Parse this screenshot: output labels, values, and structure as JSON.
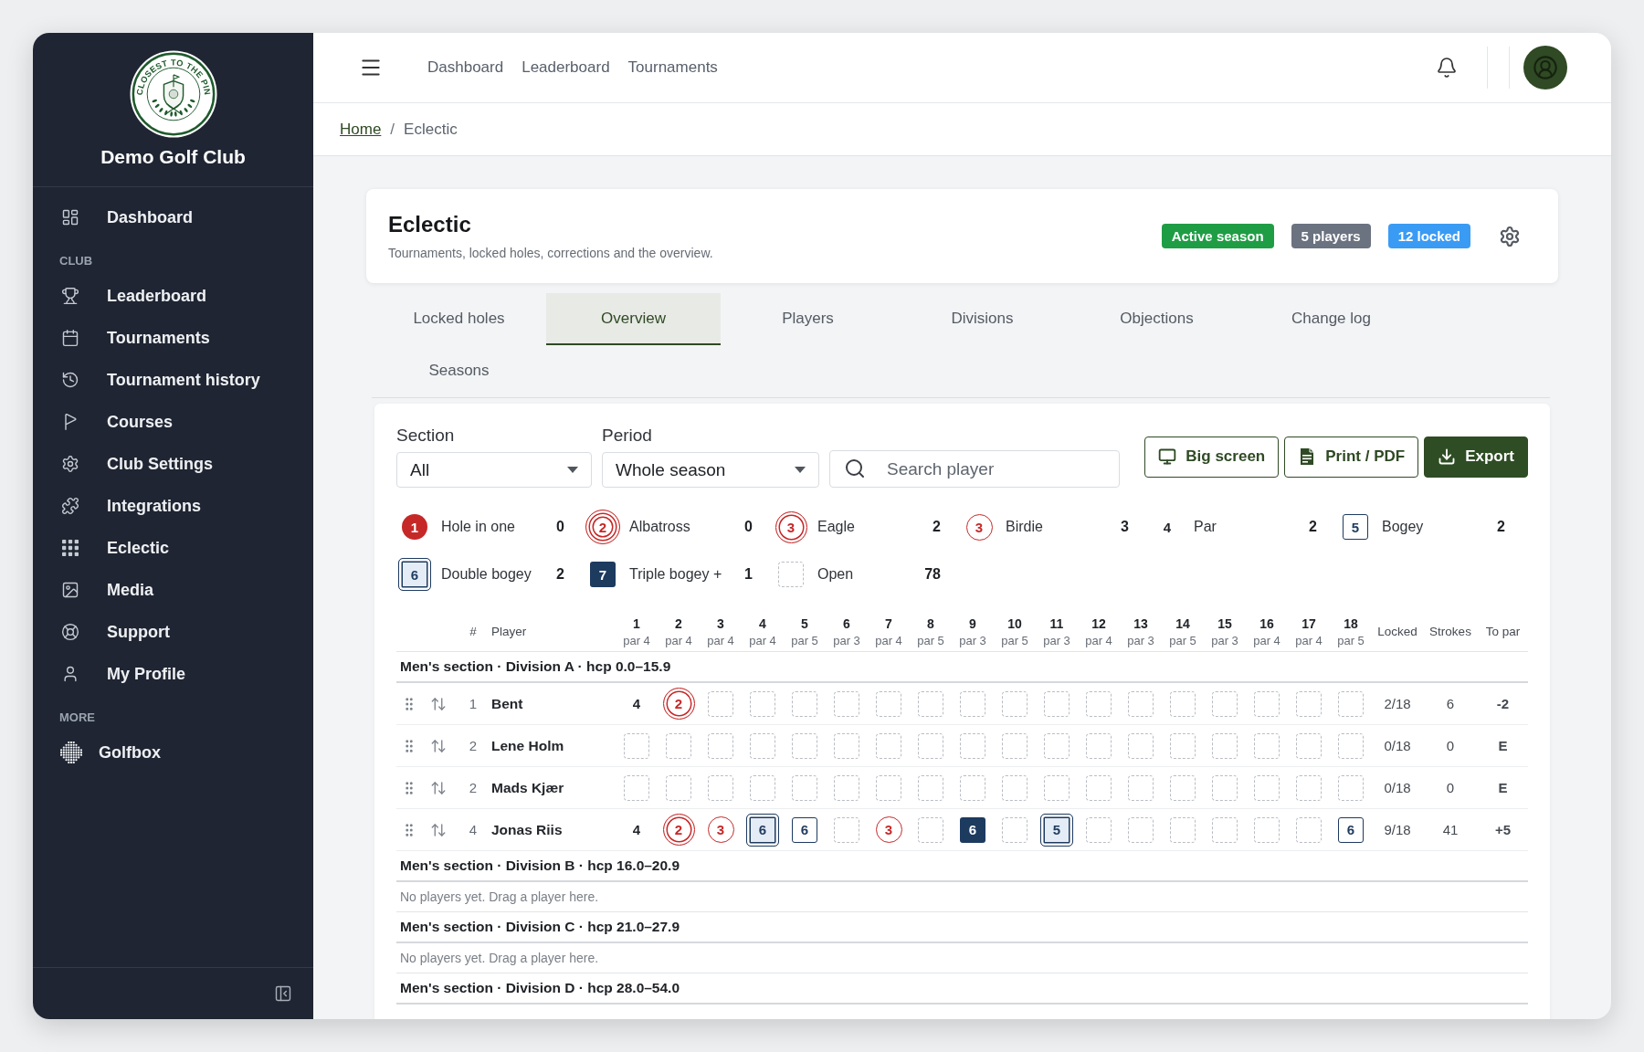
{
  "sidebar": {
    "logo_text": "CLOSEST TO THE PIN",
    "club_name": "Demo Golf Club",
    "sections": [
      {
        "items": [
          "Dashboard"
        ]
      },
      {
        "title": "CLUB",
        "items": [
          "Leaderboard",
          "Tournaments",
          "Tournament history",
          "Courses",
          "Club Settings",
          "Integrations",
          "Eclectic",
          "Media",
          "Support",
          "My Profile"
        ]
      },
      {
        "title": "MORE",
        "items": [
          "Golfbox"
        ]
      }
    ]
  },
  "top_nav": {
    "links": [
      "Dashboard",
      "Leaderboard",
      "Tournaments"
    ]
  },
  "breadcrumb": {
    "separator": "/",
    "items": [
      {
        "label": "Home",
        "link": true
      },
      {
        "label": "Eclectic",
        "link": false
      }
    ]
  },
  "header": {
    "title": "Eclectic",
    "subtitle": "Tournaments, locked holes, corrections and the overview.",
    "badges": [
      {
        "label": "Active season",
        "color": "#1f9d45"
      },
      {
        "label": "5 players",
        "color": "#6b7280"
      },
      {
        "label": "12 locked",
        "color": "#3a9bf4"
      }
    ]
  },
  "tabs": [
    {
      "label": "Locked holes",
      "selected": false
    },
    {
      "label": "Overview",
      "selected": true
    },
    {
      "label": "Players",
      "selected": false
    },
    {
      "label": "Divisions",
      "selected": false
    },
    {
      "label": "Objections",
      "selected": false
    },
    {
      "label": "Change log",
      "selected": false
    },
    {
      "label": "Seasons",
      "selected": false
    }
  ],
  "filters": {
    "section": {
      "label": "Section",
      "value": "All"
    },
    "period": {
      "label": "Period",
      "value": "Whole season"
    },
    "search": {
      "placeholder": "Search player"
    }
  },
  "actions": [
    {
      "label": "Big screen",
      "kind": "outline"
    },
    {
      "label": "Print / PDF",
      "kind": "outline"
    },
    {
      "label": "Export",
      "kind": "primary"
    }
  ],
  "legend": [
    {
      "kind": "hole_in_one",
      "sample": "1",
      "label": "Hole in one",
      "count": "0"
    },
    {
      "kind": "albatross",
      "sample": "2",
      "label": "Albatross",
      "count": "0"
    },
    {
      "kind": "eagle",
      "sample": "3",
      "label": "Eagle",
      "count": "2"
    },
    {
      "kind": "birdie",
      "sample": "3",
      "label": "Birdie",
      "count": "3"
    },
    {
      "kind": "par",
      "sample": "4",
      "label": "Par",
      "count": "2"
    },
    {
      "kind": "bogey",
      "sample": "5",
      "label": "Bogey",
      "count": "2"
    },
    {
      "kind": "double_bogey",
      "sample": "6",
      "label": "Double bogey",
      "count": "2"
    },
    {
      "kind": "triple_bogey",
      "sample": "7",
      "label": "Triple bogey +",
      "count": "1"
    },
    {
      "kind": "open",
      "label": "Open",
      "count": "78"
    }
  ],
  "table": {
    "columns": {
      "rank": "#",
      "player": "Player",
      "locked": "Locked",
      "strokes": "Strokes",
      "to_par": "To par"
    },
    "holes": [
      {
        "number": "1",
        "par": "par 4"
      },
      {
        "number": "2",
        "par": "par 4"
      },
      {
        "number": "3",
        "par": "par 4"
      },
      {
        "number": "4",
        "par": "par 4"
      },
      {
        "number": "5",
        "par": "par 5"
      },
      {
        "number": "6",
        "par": "par 3"
      },
      {
        "number": "7",
        "par": "par 4"
      },
      {
        "number": "8",
        "par": "par 5"
      },
      {
        "number": "9",
        "par": "par 3"
      },
      {
        "number": "10",
        "par": "par 5"
      },
      {
        "number": "11",
        "par": "par 3"
      },
      {
        "number": "12",
        "par": "par 4"
      },
      {
        "number": "13",
        "par": "par 3"
      },
      {
        "number": "14",
        "par": "par 5"
      },
      {
        "number": "15",
        "par": "par 3"
      },
      {
        "number": "16",
        "par": "par 4"
      },
      {
        "number": "17",
        "par": "par 4"
      },
      {
        "number": "18",
        "par": "par 5"
      }
    ],
    "groups": [
      {
        "title": "Men's section · Division A · hcp 0.0–15.9",
        "rows": [
          {
            "rank": "1",
            "player": "Bent",
            "locked": "2/18",
            "strokes": "6",
            "to_par": "-2",
            "scores": [
              {
                "kind": "par",
                "value": "4"
              },
              {
                "kind": "eagle",
                "value": "2"
              },
              {
                "kind": "open"
              },
              {
                "kind": "open"
              },
              {
                "kind": "open"
              },
              {
                "kind": "open"
              },
              {
                "kind": "open"
              },
              {
                "kind": "open"
              },
              {
                "kind": "open"
              },
              {
                "kind": "open"
              },
              {
                "kind": "open"
              },
              {
                "kind": "open"
              },
              {
                "kind": "open"
              },
              {
                "kind": "open"
              },
              {
                "kind": "open"
              },
              {
                "kind": "open"
              },
              {
                "kind": "open"
              },
              {
                "kind": "open"
              }
            ]
          },
          {
            "rank": "2",
            "player": "Lene Holm",
            "locked": "0/18",
            "strokes": "0",
            "to_par": "E",
            "scores": [
              {
                "kind": "open"
              },
              {
                "kind": "open"
              },
              {
                "kind": "open"
              },
              {
                "kind": "open"
              },
              {
                "kind": "open"
              },
              {
                "kind": "open"
              },
              {
                "kind": "open"
              },
              {
                "kind": "open"
              },
              {
                "kind": "open"
              },
              {
                "kind": "open"
              },
              {
                "kind": "open"
              },
              {
                "kind": "open"
              },
              {
                "kind": "open"
              },
              {
                "kind": "open"
              },
              {
                "kind": "open"
              },
              {
                "kind": "open"
              },
              {
                "kind": "open"
              },
              {
                "kind": "open"
              }
            ]
          },
          {
            "rank": "2",
            "player": "Mads Kjær",
            "locked": "0/18",
            "strokes": "0",
            "to_par": "E",
            "scores": [
              {
                "kind": "open"
              },
              {
                "kind": "open"
              },
              {
                "kind": "open"
              },
              {
                "kind": "open"
              },
              {
                "kind": "open"
              },
              {
                "kind": "open"
              },
              {
                "kind": "open"
              },
              {
                "kind": "open"
              },
              {
                "kind": "open"
              },
              {
                "kind": "open"
              },
              {
                "kind": "open"
              },
              {
                "kind": "open"
              },
              {
                "kind": "open"
              },
              {
                "kind": "open"
              },
              {
                "kind": "open"
              },
              {
                "kind": "open"
              },
              {
                "kind": "open"
              },
              {
                "kind": "open"
              }
            ]
          },
          {
            "rank": "4",
            "player": "Jonas Riis",
            "locked": "9/18",
            "strokes": "41",
            "to_par": "+5",
            "scores": [
              {
                "kind": "par",
                "value": "4"
              },
              {
                "kind": "eagle",
                "value": "2"
              },
              {
                "kind": "birdie",
                "value": "3"
              },
              {
                "kind": "double_bogey",
                "value": "6"
              },
              {
                "kind": "bogey",
                "value": "6"
              },
              {
                "kind": "open"
              },
              {
                "kind": "birdie",
                "value": "3"
              },
              {
                "kind": "open"
              },
              {
                "kind": "triple_bogey",
                "value": "6"
              },
              {
                "kind": "open"
              },
              {
                "kind": "double_bogey",
                "value": "5"
              },
              {
                "kind": "open"
              },
              {
                "kind": "open"
              },
              {
                "kind": "open"
              },
              {
                "kind": "open"
              },
              {
                "kind": "open"
              },
              {
                "kind": "open"
              },
              {
                "kind": "bogey",
                "value": "6"
              }
            ]
          }
        ]
      },
      {
        "title": "Men's section · Division B · hcp 16.0–20.9",
        "empty_text": "No players yet. Drag a player here."
      },
      {
        "title": "Men's section · Division C · hcp 21.0–27.9",
        "empty_text": "No players yet. Drag a player here."
      },
      {
        "title": "Men's section · Division D · hcp 28.0–54.0"
      }
    ]
  }
}
